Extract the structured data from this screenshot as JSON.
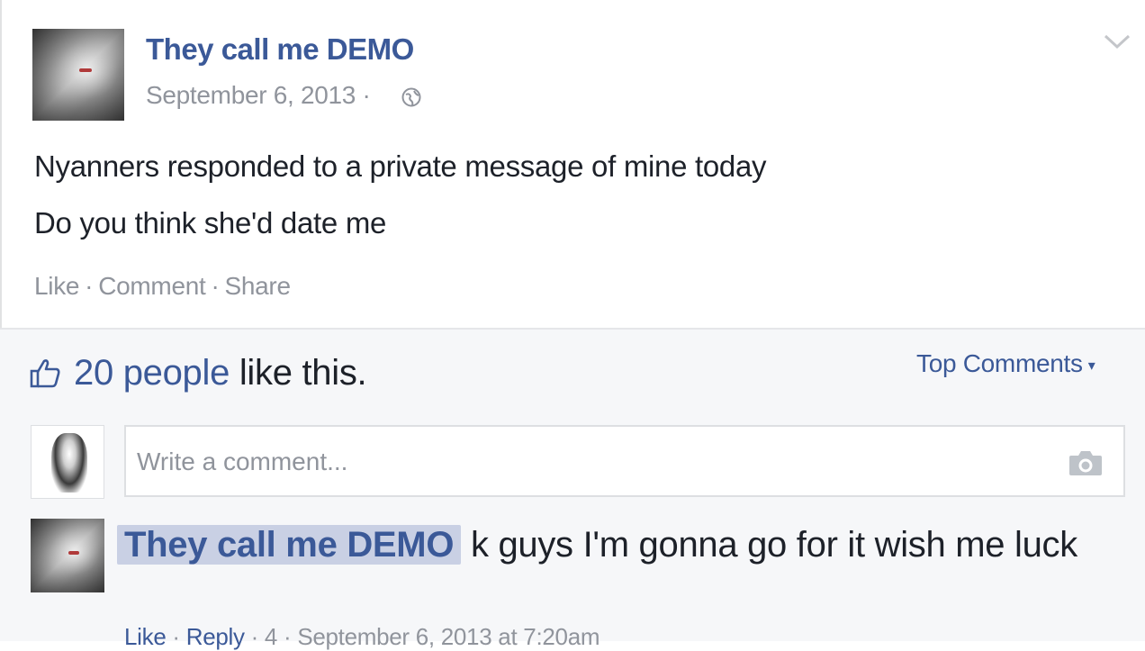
{
  "post": {
    "author": "They call me DEMO",
    "timestamp": "September 6, 2013 ·",
    "privacy_icon": "globe-icon",
    "options_icon": "chevron-down-icon",
    "text_line1": "Nyanners responded to a private message of mine today",
    "text_line2": "Do you think she'd date me",
    "actions": {
      "like": "Like",
      "comment": "Comment",
      "share": "Share",
      "separator": "·"
    }
  },
  "likes": {
    "icon": "thumbs-up-icon",
    "count_text": "20 people",
    "suffix": " like this."
  },
  "sort": {
    "label": "Top Comments",
    "caret": "▾"
  },
  "composer": {
    "placeholder": "Write a comment...",
    "camera_icon": "camera-icon"
  },
  "comment": {
    "author": "They call me DEMO",
    "text": " k guys I'm gonna go for it wish me luck",
    "meta": {
      "like": "Like",
      "reply": "Reply",
      "like_count": "4",
      "timestamp": "September 6, 2013 at 7:20am"
    }
  },
  "colors": {
    "link_blue": "#3b5998",
    "meta_gray": "#90949c",
    "comment_area_bg": "#f6f7f9",
    "author_highlight": "#c9d0e4"
  }
}
